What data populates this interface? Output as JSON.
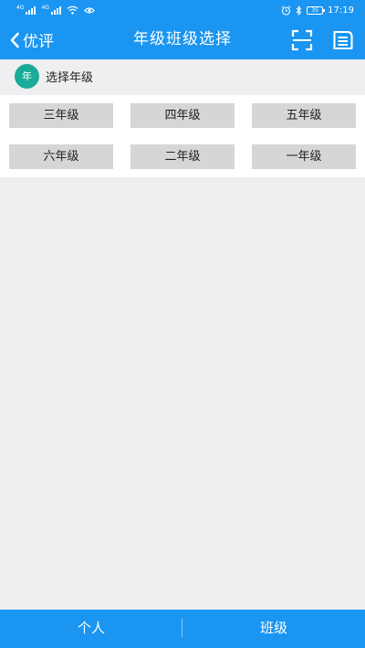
{
  "status_bar": {
    "network_left": "4G",
    "network_right": "4G",
    "battery": "35",
    "time": "17:19"
  },
  "header": {
    "back_label": "优评",
    "title": "年级班级选择"
  },
  "section": {
    "badge": "年",
    "title": "选择年级"
  },
  "grades": [
    {
      "label": "三年级"
    },
    {
      "label": "四年级"
    },
    {
      "label": "五年级"
    },
    {
      "label": "六年级"
    },
    {
      "label": "二年级"
    },
    {
      "label": "一年级"
    }
  ],
  "bottom_nav": {
    "tabs": [
      {
        "label": "个人"
      },
      {
        "label": "班级"
      }
    ]
  },
  "colors": {
    "primary": "#1a95f1",
    "badge": "#1aac98",
    "grade_button": "#d6d6d6",
    "background": "#eeeff1"
  }
}
